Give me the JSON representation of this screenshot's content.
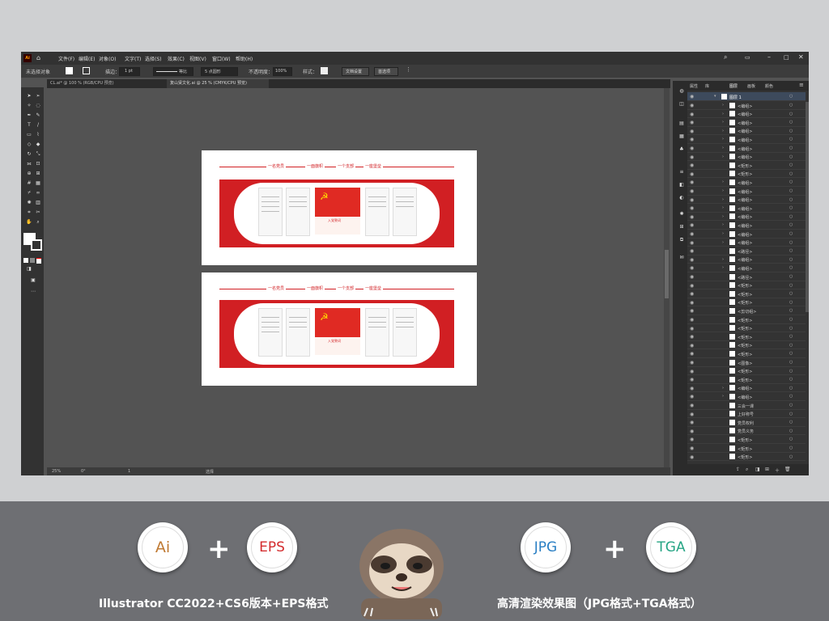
{
  "app": {
    "logo": "Ai",
    "menu": [
      "文件(F)",
      "编辑(E)",
      "对象(O)",
      "文字(T)",
      "选择(S)",
      "效果(C)",
      "视图(V)",
      "窗口(W)",
      "帮助(H)"
    ],
    "control": {
      "selection": "未选择对象",
      "stroke_label": "描边：",
      "stroke_value": "1 pt",
      "stroke_style": "等比",
      "brush": "5 点圆形",
      "opacity_label": "不透明度：",
      "opacity_value": "100%",
      "style_label": "样式：",
      "doc_setup": "文档设置",
      "prefs": "首选项"
    },
    "tabs": [
      {
        "label": "CL.ai* @ 100 % (RGB/CPU 预览)",
        "active": false
      },
      {
        "label": "复山贤文化.ai @ 25 % (CMYK/CPU 预览)",
        "active": true
      }
    ],
    "status": {
      "zoom": "25%",
      "rotation": "0°",
      "page": "1",
      "mode": "选择"
    },
    "panel": {
      "tabs": [
        "属性",
        "库",
        "图层",
        "画板",
        "颜色"
      ],
      "layer_name": "图层 1",
      "rows": [
        "<编组>",
        "<编组>",
        "<编组>",
        "<编组>",
        "<编组>",
        "<编组>",
        "<编组>",
        "<矩形>",
        "<矩形>",
        "<编组>",
        "<编组>",
        "<编组>",
        "<编组>",
        "<编组>",
        "<编组>",
        "<编组>",
        "<编组>",
        "<路径>",
        "<编组>",
        "<编组>",
        "<路径>",
        "<矩形>",
        "<矩形>",
        "<矩形>",
        "<剪切组>",
        "<矩形>",
        "<矩形>",
        "<矩形>",
        "<矩形>",
        "<矩形>",
        "<图像>",
        "<矩形>",
        "<矩形>",
        "<编组>",
        "<编组>",
        "三会一课",
        "上好称号",
        "党员权利",
        "党员义务",
        "<矩形>",
        "<矩形>",
        "<矩形>"
      ]
    }
  },
  "artboards": [
    {
      "header": [
        "一名党员",
        "一面旗帜",
        "一个支部",
        "一座堡垒"
      ],
      "center_title": "入党誓词"
    },
    {
      "header": [
        "一名党员",
        "一面旗帜",
        "一个支部",
        "一座堡垒"
      ],
      "center_title": "入党誓词"
    }
  ],
  "banner": {
    "badges": [
      {
        "label": "Ai",
        "color": "#c07a33"
      },
      {
        "label": "EPS",
        "color": "#d42d2f"
      },
      {
        "label": "JPG",
        "color": "#2a7fc4"
      },
      {
        "label": "TGA",
        "color": "#27a585"
      }
    ],
    "plus": "+",
    "caption_left": "Illustrator CC2022+CS6版本+EPS格式",
    "caption_right": "高清渲染效果图（JPG格式+TGA格式）"
  },
  "colors": {
    "party_red": "#d11f23",
    "ui_dark": "#323232",
    "canvas": "#535353"
  }
}
